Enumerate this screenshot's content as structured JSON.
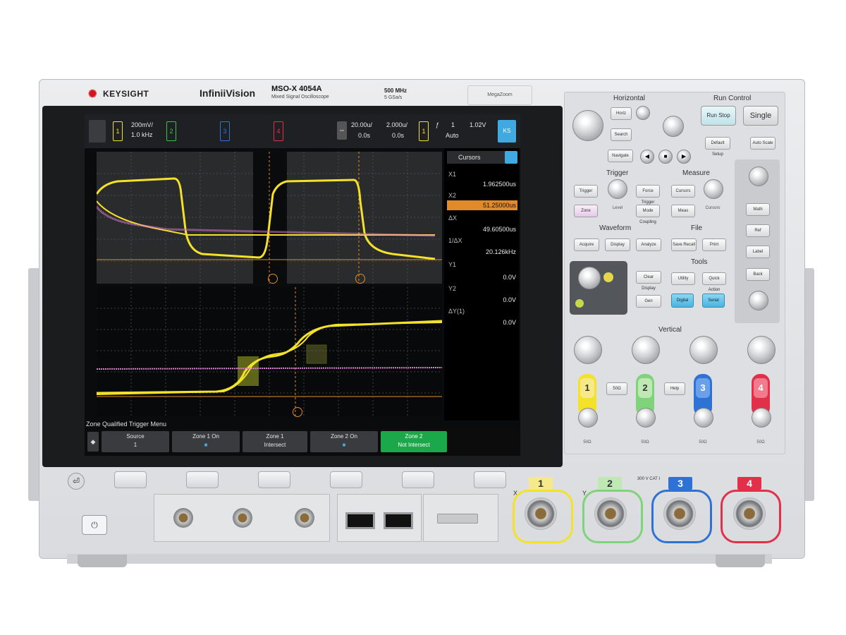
{
  "brand": {
    "logo": "KEYSIGHT",
    "series": "InfiniiVision",
    "model": "MSO-X 4054A",
    "model_sub": "Mixed Signal Oscilloscope",
    "bandwidth": "500 MHz",
    "bandwidth_sub": "5 GSa/s",
    "badge": "MegaZoom"
  },
  "colors": {
    "ch1": "#f4e22a",
    "ch2": "#3cc44a",
    "ch3": "#2f72d6",
    "ch4": "#e2304a",
    "math_trace": "#e07bd6",
    "softkey_active": "#1aa84a"
  },
  "status": {
    "ch1_scale": "200mV/",
    "ch1_offset": "1.0 kHz",
    "ch1_key": "1",
    "ch2_key": "2",
    "ch3_key": "3",
    "ch4_key": "4",
    "timebase": "20.00u/",
    "time_delay": "0.0s",
    "zoom_scale": "2.000u/",
    "zoom_delay": "0.0s",
    "trig_src": "1",
    "trig_mode": "Auto",
    "trig_level": "1.02V",
    "trig_count": "1",
    "logo_chip": "KS"
  },
  "cursor_panel": {
    "header": "Cursors",
    "x1_label": "X1",
    "x1_value": "1.962500us",
    "x2_label": "X2",
    "x2_value": "51.25000us",
    "dx_label": "ΔX",
    "dx_value": "49.60500us",
    "inv_label": "1/ΔX",
    "inv_value": "20.126kHz",
    "y1_label": "Y1",
    "y1_value": "0.0V",
    "y2_label": "Y2",
    "y2_value": "0.0V",
    "dy_label": "ΔY(1)",
    "dy_value": "0.0V"
  },
  "menu": {
    "title": "Zone Qualified Trigger Menu",
    "softkeys": [
      {
        "l1": "Source",
        "l2": "1"
      },
      {
        "l1": "Zone 1 On",
        "l2": "■"
      },
      {
        "l1": "Zone 1",
        "l2": "Intersect"
      },
      {
        "l1": "Zone 2 On",
        "l2": "■"
      },
      {
        "l1": "Zone 2",
        "l2": "Not Intersect"
      }
    ]
  },
  "controls": {
    "horizontal": "Horizontal",
    "run_control": "Run Control",
    "run_stop": "Run Stop",
    "single": "Single",
    "default_setup": "Default Setup",
    "auto_scale": "Auto Scale",
    "horiz_btn": "Horiz",
    "search": "Search",
    "navigate": "Navigate",
    "trigger": "Trigger",
    "trigger_btn": "Trigger",
    "force_trigger": "Force Trigger",
    "zone": "Zone",
    "level": "Level",
    "mode_coupling": "Mode Coupling",
    "measure": "Measure",
    "cursors_btn": "Cursors",
    "meas_btn": "Meas",
    "cursors": "Cursors",
    "waveform": "Waveform",
    "acquire": "Acquire",
    "display": "Display",
    "file": "File",
    "save_recall": "Save Recall",
    "print": "Print",
    "tools": "Tools",
    "utility": "Utility",
    "quick_action": "Quick Action",
    "clear_display": "Clear Display",
    "analyze": "Analyze",
    "back": "Back",
    "wavegen": "Gen",
    "vertical": "Vertical",
    "math": "Math",
    "ref": "Ref",
    "label": "Label",
    "digital": "Digital",
    "serial": "Serial",
    "help": "Help",
    "ch1_50": "50Ω",
    "ch2_50": "50Ω",
    "ch3_50": "50Ω",
    "ch4_50": "50Ω"
  },
  "inputs": {
    "ch1": "1",
    "ch2": "2",
    "ch3": "3",
    "ch4": "4",
    "x_label": "X",
    "y_label": "Y",
    "rating": "300 V CAT I"
  }
}
